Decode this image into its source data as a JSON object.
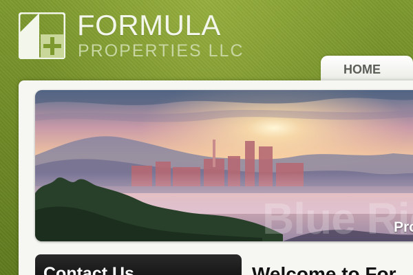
{
  "header": {
    "brand_name": "FORMULA",
    "brand_sub": "PROPERTIES LLC"
  },
  "nav": {
    "home_label": "HOME"
  },
  "hero": {
    "watermark_text": "Blue Ridg",
    "caption": "Pro"
  },
  "contact": {
    "title": "Contact Us"
  },
  "main": {
    "welcome_heading": "Welcome to For"
  },
  "colors": {
    "background_green": "#7e9a2f",
    "panel": "#f6f6f3",
    "tab": "#ffffff",
    "contact_bg": "#1e1e1e"
  },
  "icons": {
    "logo": "house-plus-logo-icon"
  }
}
